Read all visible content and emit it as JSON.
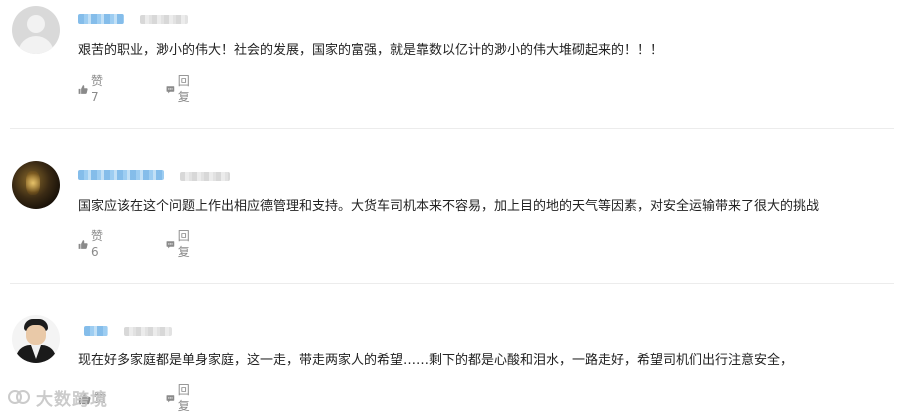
{
  "comments": [
    {
      "text": "艰苦的职业，渺小的伟大！社会的发展，国家的富强，就是靠数以亿计的渺小的伟大堆砌起来的！！！",
      "like_label": "赞7",
      "reply_label": "回复"
    },
    {
      "text": "国家应该在这个问题上作出相应德管理和支持。大货车司机本来不容易，加上目的地的天气等因素，对安全运输带来了很大的挑战",
      "like_label": "赞6",
      "reply_label": "回复"
    },
    {
      "text": "现在好多家庭都是单身家庭，这一走，带走两家人的希望……剩下的都是心酸和泪水，一路走好，希望司机们出行注意安全，",
      "like_label": "赞",
      "reply_label": "回复"
    }
  ],
  "watermark": {
    "text": "大数跨境",
    "icon": "brand-logo-icon"
  },
  "colors": {
    "text": "#222222",
    "meta": "#8a8a8a",
    "username_blur": "#6fb1e6",
    "divider": "#ececec"
  }
}
